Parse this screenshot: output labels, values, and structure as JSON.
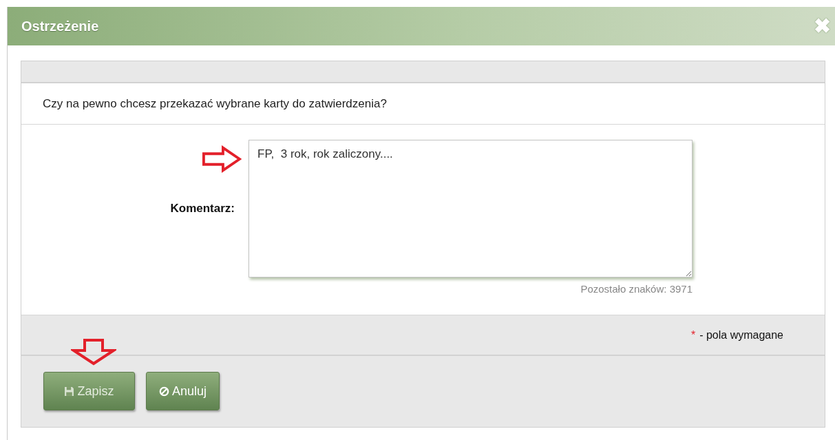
{
  "window": {
    "title": "Ostrzeżenie",
    "close": "✖"
  },
  "message": "Czy na pewno chcesz przekazać wybrane karty do zatwierdzenia?",
  "comment": {
    "label": "Komentarz:",
    "value": "FP,  3 rok, rok zaliczony....",
    "remaining": "Pozostało znaków: 3971"
  },
  "required_note": {
    "mark": "*",
    "text": "- pola wymagane"
  },
  "buttons": [
    {
      "kind": "save",
      "label": "Zapisz"
    },
    {
      "kind": "cancel",
      "label": "Anuluj"
    }
  ]
}
